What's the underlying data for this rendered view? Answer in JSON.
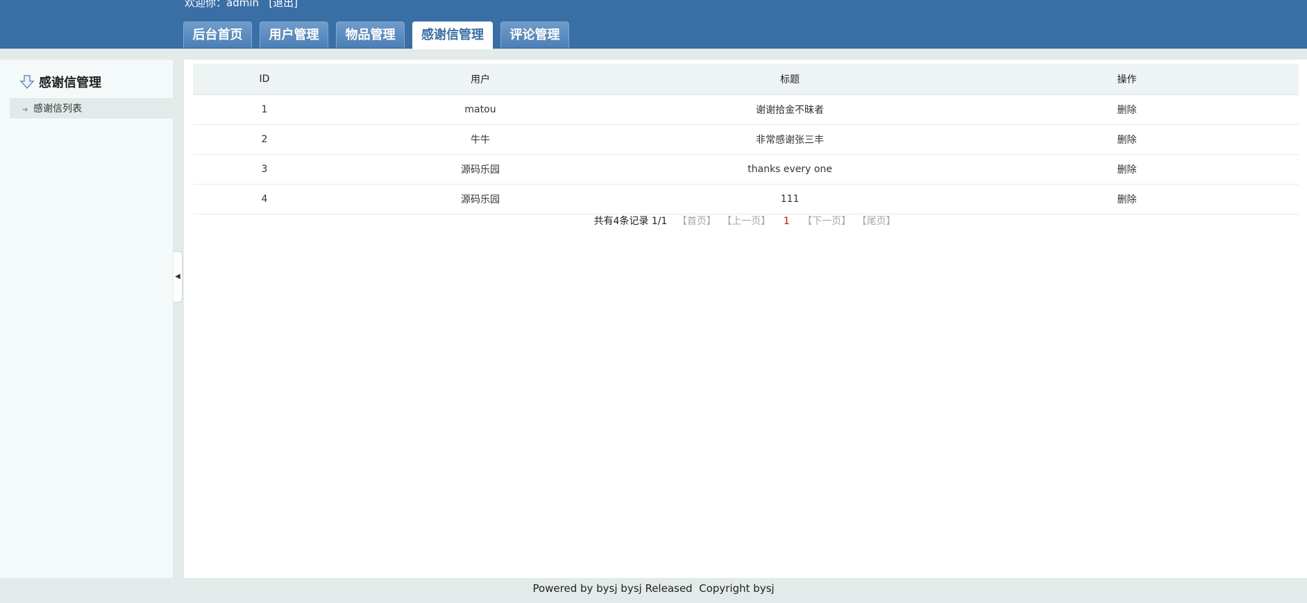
{
  "header": {
    "welcome_text": "欢迎你：admin",
    "logout_label": "[退出]",
    "tabs": [
      {
        "label": "后台首页"
      },
      {
        "label": "用户管理"
      },
      {
        "label": "物品管理"
      },
      {
        "label": "感谢信管理",
        "active": true
      },
      {
        "label": "评论管理"
      }
    ]
  },
  "sidebar": {
    "title": "感谢信管理",
    "items": [
      {
        "label": "感谢信列表"
      }
    ],
    "collapse_icon": "◀"
  },
  "table": {
    "columns": [
      "ID",
      "用户",
      "标题",
      "操作"
    ],
    "rows": [
      {
        "id": "1",
        "user": "matou",
        "title": "谢谢拾金不昧者",
        "action": "删除"
      },
      {
        "id": "2",
        "user": "牛牛",
        "title": "非常感谢张三丰",
        "action": "删除"
      },
      {
        "id": "3",
        "user": "源码乐园",
        "title": "thanks every one",
        "action": "删除"
      },
      {
        "id": "4",
        "user": "源码乐园",
        "title": "111",
        "action": "删除"
      }
    ]
  },
  "pager": {
    "summary": "共有4条记录  1/1",
    "first": "【首页】",
    "prev": "【上一页】",
    "current": "1",
    "next": "【下一页】",
    "last": "【尾页】"
  },
  "footer": {
    "text": "Powered by bysj bysj Released  Copyright bysj"
  },
  "colors": {
    "header_bg": "#3a6fa6",
    "page_bg": "#e3eaea",
    "current_page": "#dd0000"
  }
}
